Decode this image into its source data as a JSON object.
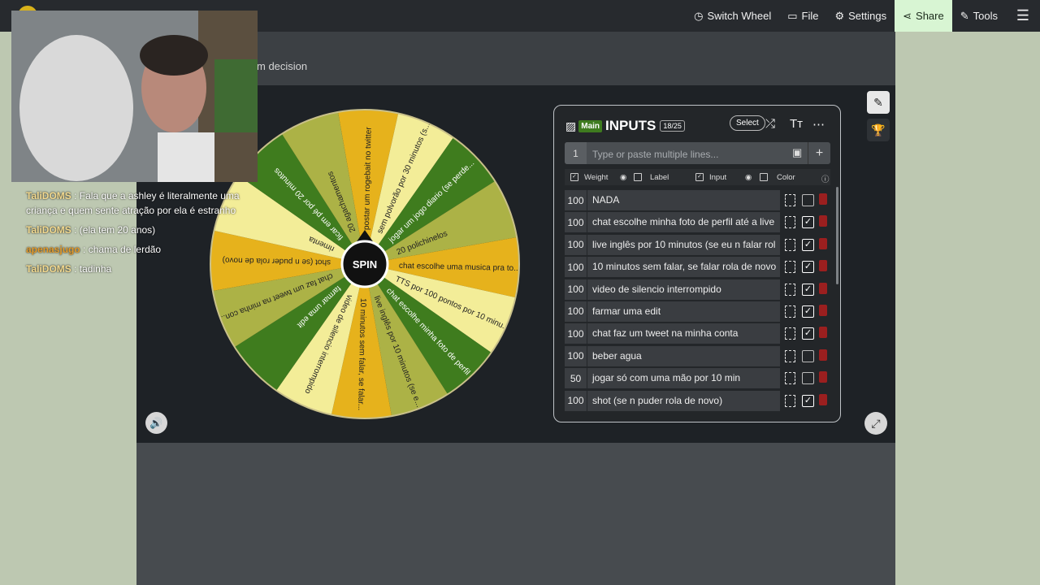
{
  "topbar": {
    "items": [
      {
        "icon": "clock-icon",
        "label": "Switch Wheel"
      },
      {
        "icon": "folder-icon",
        "label": "File"
      },
      {
        "icon": "gear-icon",
        "label": "Settings"
      },
      {
        "icon": "share-icon",
        "label": "Share"
      },
      {
        "icon": "wrench-icon",
        "label": "Tools"
      }
    ]
  },
  "page": {
    "subtitle_fragment": "m decision"
  },
  "wheel": {
    "center_label": "SPIN",
    "slices": [
      {
        "label": "postar um rogebait no twitter",
        "color": "#e6b21c"
      },
      {
        "label": "sem polvorão por 30 minutos (s...",
        "color": "#f3ed98"
      },
      {
        "label": "jogar um jogo diario (se perde...",
        "color": "#3f7c1e"
      },
      {
        "label": "20 polichinelos",
        "color": "#acb246"
      },
      {
        "label": "chat escolhe uma musica pra to...",
        "color": "#e6b21c"
      },
      {
        "label": "TTS por 100 pontos por 10 minu...",
        "color": "#f3ed98"
      },
      {
        "label": "chat escolhe minha foto de perfil",
        "color": "#3f7c1e"
      },
      {
        "label": "live inglês por 10 minutos (se e...",
        "color": "#acb246"
      },
      {
        "label": "10 minutos sem falar, se falar...",
        "color": "#e6b21c"
      },
      {
        "label": "video de silencio interrompido",
        "color": "#f3ed98"
      },
      {
        "label": "farmar uma edit",
        "color": "#3f7c1e"
      },
      {
        "label": "chat faz um tweet na minha con...",
        "color": "#acb246"
      },
      {
        "label": "shot (se n puder rola de novo)",
        "color": "#e6b21c"
      },
      {
        "label": "rimenta",
        "color": "#f3ed98"
      },
      {
        "label": "ficar em pé por 20 minutos",
        "color": "#3f7c1e"
      },
      {
        "label": "20 agachamentos",
        "color": "#acb246"
      }
    ]
  },
  "panel": {
    "badge": "Main",
    "title": "INPUTS",
    "count": "18/25",
    "select_label": "Select",
    "entry_number": "1",
    "entry_placeholder": "Type or paste multiple lines...",
    "columns": [
      "Weight",
      "Label",
      "Input",
      "Color"
    ],
    "rows": [
      {
        "weight": "100",
        "text": "NADA",
        "checked": false
      },
      {
        "weight": "100",
        "text": "chat escolhe minha foto de perfil até a live",
        "checked": true
      },
      {
        "weight": "100",
        "text": "live inglês por 10 minutos (se eu n falar rol",
        "checked": true
      },
      {
        "weight": "100",
        "text": "10 minutos sem falar, se falar rola de novo",
        "checked": true
      },
      {
        "weight": "100",
        "text": "video de silencio interrompido",
        "checked": true
      },
      {
        "weight": "100",
        "text": "farmar uma edit",
        "checked": true
      },
      {
        "weight": "100",
        "text": "chat faz um tweet na minha conta",
        "checked": true
      },
      {
        "weight": "100",
        "text": "beber agua",
        "checked": false
      },
      {
        "weight": "50",
        "text": "jogar só com uma mão por 10 min",
        "checked": false
      },
      {
        "weight": "100",
        "text": "shot (se n puder rola de novo)",
        "checked": true
      }
    ]
  },
  "chat": [
    {
      "user": "TaliDOMS",
      "msg": "Fala que a ashley é literalmente uma criança e quem sente atração por ela é estranho"
    },
    {
      "user": "TaliDOMS",
      "msg": "(ela tem 20 anos)"
    },
    {
      "user": "apenasjugo",
      "msg": "chama de lerdão"
    },
    {
      "user": "TaliDOMS",
      "msg": "tadinha"
    }
  ]
}
